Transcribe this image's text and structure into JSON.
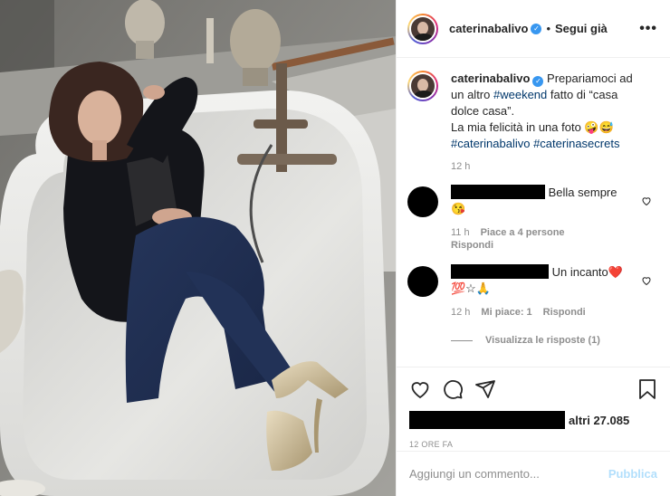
{
  "header": {
    "username": "caterinabalivo",
    "separator": "•",
    "follow_label": "Segui già",
    "more_label": "•••"
  },
  "caption": {
    "username": "caterinabalivo",
    "text_1": " Prepariamoci ad un altro ",
    "hashtag_1": "#weekend",
    "text_2": " fatto di “casa dolce casa”.",
    "text_3": "La mia felicità in una foto 🤪😅",
    "hashtag_2": "#caterinabalivo",
    "hashtag_3": "#caterinasecrets",
    "time": "12 h"
  },
  "comments": [
    {
      "text": "Bella sempre",
      "emoji_line": "😘",
      "time": "11 h",
      "likes": "Piace a 4 persone",
      "reply_label": "Rispondi"
    },
    {
      "text": "Un incanto❤️",
      "emoji_line": "💯☆🙏",
      "time": "12 h",
      "likes": "Mi piace: 1",
      "reply_label": "Rispondi",
      "view_replies": "Visualizza le risposte (1)"
    }
  ],
  "likes": {
    "count_label": "altri 27.085"
  },
  "post_time": "12 ORE FA",
  "add_comment": {
    "placeholder": "Aggiungi un commento...",
    "publish_label": "Pubblica"
  },
  "icons": [
    "heart-icon",
    "comment-icon",
    "share-icon",
    "bookmark-icon"
  ],
  "colors": {
    "link": "#00376b",
    "meta": "#8e8e8e",
    "publish_disabled": "#b2dffc",
    "verified": "#3897f0"
  }
}
